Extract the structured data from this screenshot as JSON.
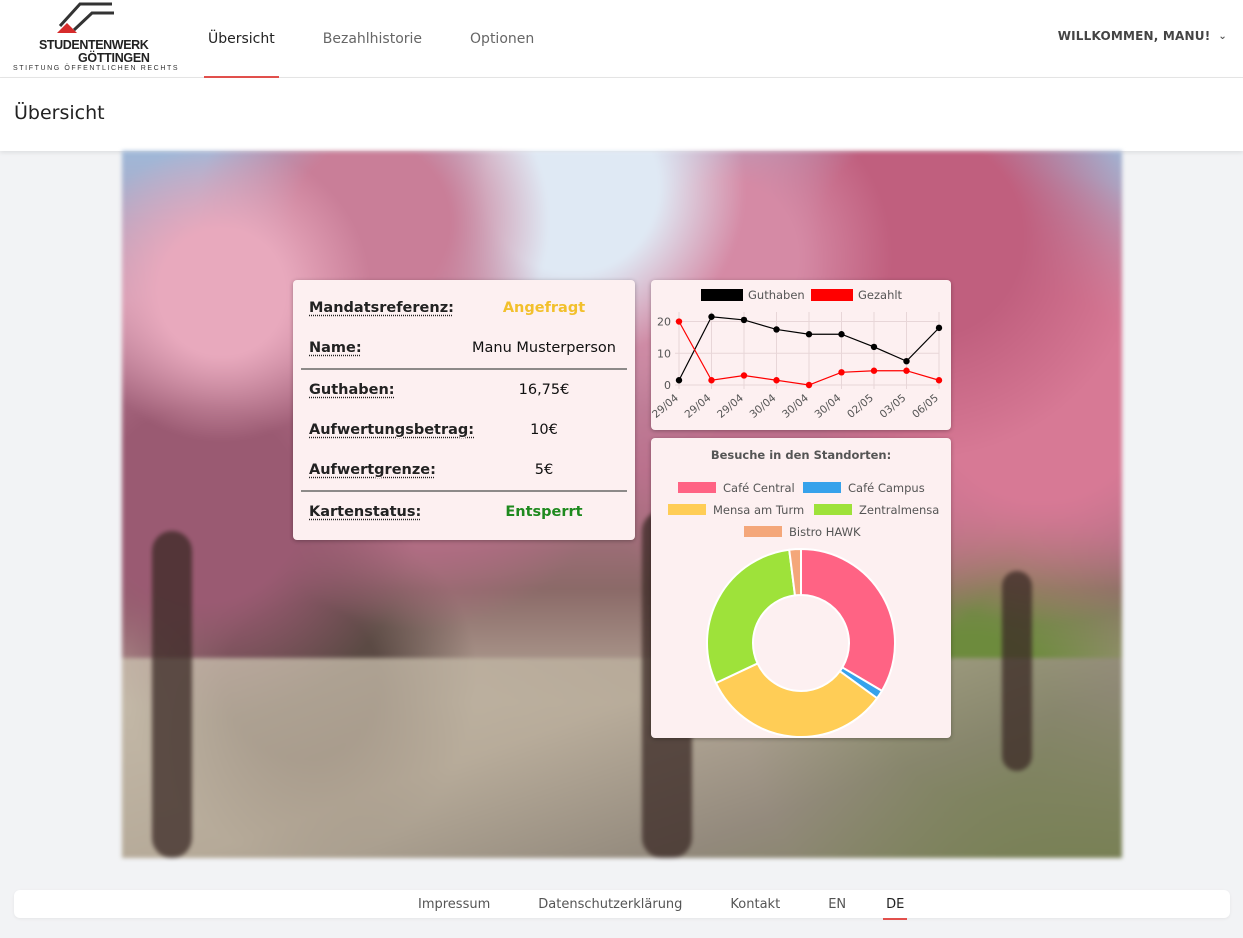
{
  "brand": {
    "line1": "STUDENTENWERK",
    "line2": "GÖTTINGEN",
    "line3": "STIFTUNG ÖFFENTLICHEN RECHTS",
    "colors": {
      "accent": "#e2504c",
      "logo_red": "#d62b2b"
    }
  },
  "nav": {
    "tabs": [
      {
        "label": "Übersicht",
        "active": true
      },
      {
        "label": "Bezahlhistorie",
        "active": false
      },
      {
        "label": "Optionen",
        "active": false
      }
    ]
  },
  "user": {
    "greeting": "WILLKOMMEN, MANU!",
    "icon": "chevron-down-icon"
  },
  "page": {
    "title": "Übersicht"
  },
  "card": {
    "rows": [
      {
        "label": "Mandatsreferenz:",
        "value": "Angefragt",
        "status": "yellow"
      },
      {
        "label": "Name:",
        "value": "Manu Musterperson"
      },
      {
        "label": "Guthaben:",
        "value": "16,75€"
      },
      {
        "label": "Aufwertungsbetrag:",
        "value": "10€"
      },
      {
        "label": "Aufwertgrenze:",
        "value": "5€"
      },
      {
        "label": "Kartenstatus:",
        "value": "Entsperrt",
        "status": "green"
      }
    ]
  },
  "chart_data": [
    {
      "type": "line",
      "title": "",
      "x": [
        "29/04",
        "29/04",
        "29/04",
        "30/04",
        "30/04",
        "30/04",
        "02/05",
        "03/05",
        "06/05"
      ],
      "series": [
        {
          "name": "Guthaben",
          "color": "#000000",
          "values": [
            1.5,
            21.5,
            20.5,
            17.5,
            16,
            16,
            12,
            7.5,
            18
          ]
        },
        {
          "name": "Gezahlt",
          "color": "#ff0000",
          "values": [
            20,
            1.5,
            3,
            1.5,
            0,
            4,
            4.5,
            4.5,
            1.5
          ]
        }
      ],
      "yticks": [
        0,
        10,
        20
      ],
      "ylim": [
        0,
        23
      ],
      "legend": "top",
      "grid": true
    },
    {
      "type": "pie",
      "title": "Besuche in den Standorten:",
      "categories": [
        "Café Central",
        "Café Campus",
        "Mensa am Turm",
        "Zentralmensa",
        "Bistro HAWK"
      ],
      "values": [
        33.5,
        1.5,
        33,
        30,
        2
      ],
      "colors": [
        "#ff6384",
        "#36a2eb",
        "#ffcd56",
        "#9ee23a",
        "#f4a77a"
      ],
      "legend": "top",
      "donut": true
    }
  ],
  "footer": {
    "links": [
      "Impressum",
      "Datenschutzerklärung",
      "Kontakt"
    ],
    "languages": [
      {
        "code": "EN",
        "active": false
      },
      {
        "code": "DE",
        "active": true
      }
    ]
  }
}
